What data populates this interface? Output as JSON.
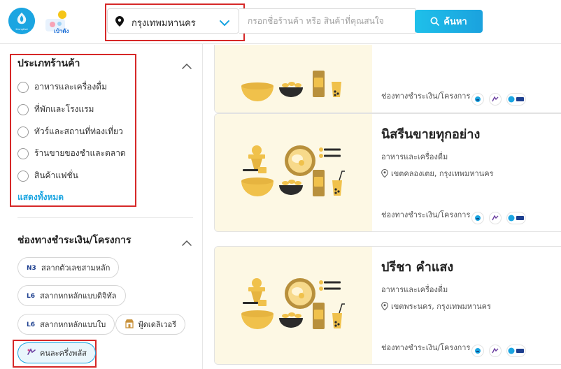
{
  "header": {
    "ktb_logo_text": "Krungthai",
    "pao_logo_text": "เป๋าตัง",
    "location": "กรุงเทพมหานคร",
    "search_placeholder": "กรอกชื่อร้านค้า หรือ สินค้าที่คุณสนใจ",
    "search_button": "ค้นหา",
    "accent": "#1ba5e1"
  },
  "sidebar": {
    "category_title": "ประเภทร้านค้า",
    "categories": [
      {
        "label": "อาหารและเครื่องดื่ม"
      },
      {
        "label": "ที่พักและโรงแรม"
      },
      {
        "label": "ทัวร์และสถานที่ท่องเที่ยว"
      },
      {
        "label": "ร้านขายของชำและตลาด"
      },
      {
        "label": "สินค้าแฟชั่น"
      }
    ],
    "show_all": "แสดงทั้งหมด",
    "payment_title": "ช่องทางชำระเงิน/โครงการ",
    "payment_chips": [
      {
        "label": "สลากตัวเลขสามหลัก",
        "icon": "n3-lottery-icon"
      },
      {
        "label": "สลากหกหลักแบบดิจิทัล",
        "icon": "l6-lottery-icon"
      },
      {
        "label": "สลากหกหลักแบบใบ",
        "icon": "l6-lottery-icon"
      },
      {
        "label": "ฟู้ดเดลิเวอรี",
        "icon": "shop-icon"
      },
      {
        "label": "คนละครึ่งพลัส",
        "icon": "half-half-icon",
        "selected": true
      }
    ]
  },
  "cards": [
    {
      "title": "",
      "category": "",
      "address": "",
      "payment_label": "ช่องทางชำระเงิน/โครงการ :"
    },
    {
      "title": "นิสรีนขายทุกอย่าง",
      "category": "อาหารและเครื่องดื่ม",
      "address": "เขตคลองเตย, กรุงเทพมหานคร",
      "payment_label": "ช่องทางชำระเงิน/โครงการ :"
    },
    {
      "title": "ปรีชา คำแสง",
      "category": "อาหารและเครื่องดื่ม",
      "address": "เขตพระนคร, กรุงเทพมหานคร",
      "payment_label": "ช่องทางชำระเงิน/โครงการ :"
    }
  ]
}
